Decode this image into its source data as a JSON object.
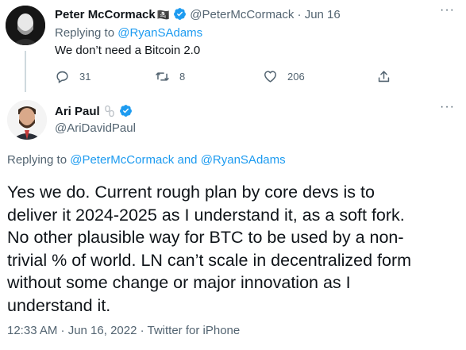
{
  "parent_tweet": {
    "author_name": "Peter McCormack",
    "name_emoji": "🏴‍☠️",
    "handle": "@PeterMcCormack",
    "separator": "·",
    "date": "Jun 16",
    "replying_prefix": "Replying to",
    "replying_to": "@RyanSAdams",
    "text": "We don’t need a Bitcoin 2.0",
    "reply_count": "31",
    "retweet_count": "8",
    "like_count": "206"
  },
  "main_tweet": {
    "author_name": "Ari Paul",
    "handle": "@AriDavidPaul",
    "replying_prefix": "Replying to",
    "replying_to_1": "@PeterMcCormack",
    "replying_and": "and",
    "replying_to_2": "@RyanSAdams",
    "text_lines": [
      "Yes we do.  Current rough plan by core devs is to",
      "deliver it 2024-2025 as I understand it, as a soft fork.",
      "No other plausible way for BTC to be used by a non-",
      "trivial % of world.  LN can’t scale in decentralized form",
      "without some change or major innovation as I",
      "understand it."
    ],
    "timestamp": "12:33 AM · Jun 16, 2022 · Twitter for iPhone"
  },
  "colors": {
    "accent": "#1d9bf0",
    "secondary_text": "#536471",
    "primary_text": "#0f1419"
  },
  "icons": [
    "more-icon",
    "reply-icon",
    "retweet-icon",
    "like-icon",
    "share-icon",
    "verified-badge-icon",
    "chain-link-emoji"
  ]
}
